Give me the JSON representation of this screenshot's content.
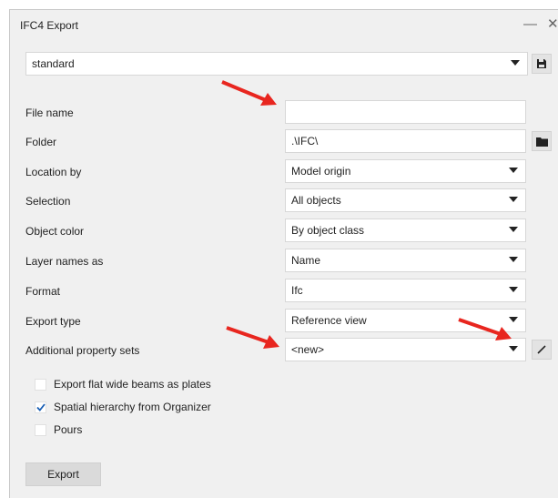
{
  "window": {
    "title": "IFC4 Export",
    "minimize_glyph": "—",
    "close_glyph": "✕"
  },
  "preset": {
    "value": "standard",
    "save_icon": "save-icon"
  },
  "fields": {
    "file_name": {
      "label": "File name",
      "value": ""
    },
    "folder": {
      "label": "Folder",
      "value": ".\\IFC\\",
      "browse_icon": "folder-icon"
    },
    "location_by": {
      "label": "Location by",
      "value": "Model origin"
    },
    "selection": {
      "label": "Selection",
      "value": "All objects"
    },
    "object_color": {
      "label": "Object color",
      "value": "By object class"
    },
    "layer_names_as": {
      "label": "Layer names as",
      "value": "Name"
    },
    "format": {
      "label": "Format",
      "value": "Ifc"
    },
    "export_type": {
      "label": "Export type",
      "value": "Reference view"
    },
    "additional_property_sets": {
      "label": "Additional property sets",
      "value": "<new>",
      "edit_icon": "pencil-icon"
    }
  },
  "checkboxes": [
    {
      "label": "Export flat wide beams as plates",
      "checked": false
    },
    {
      "label": "Spatial hierarchy from Organizer",
      "checked": true
    },
    {
      "label": "Pours",
      "checked": false
    }
  ],
  "export_button": {
    "label": "Export"
  },
  "colors": {
    "annotation_arrow": "#e8261f",
    "window_bg": "#f0f0f0",
    "field_bg": "#ffffff"
  }
}
